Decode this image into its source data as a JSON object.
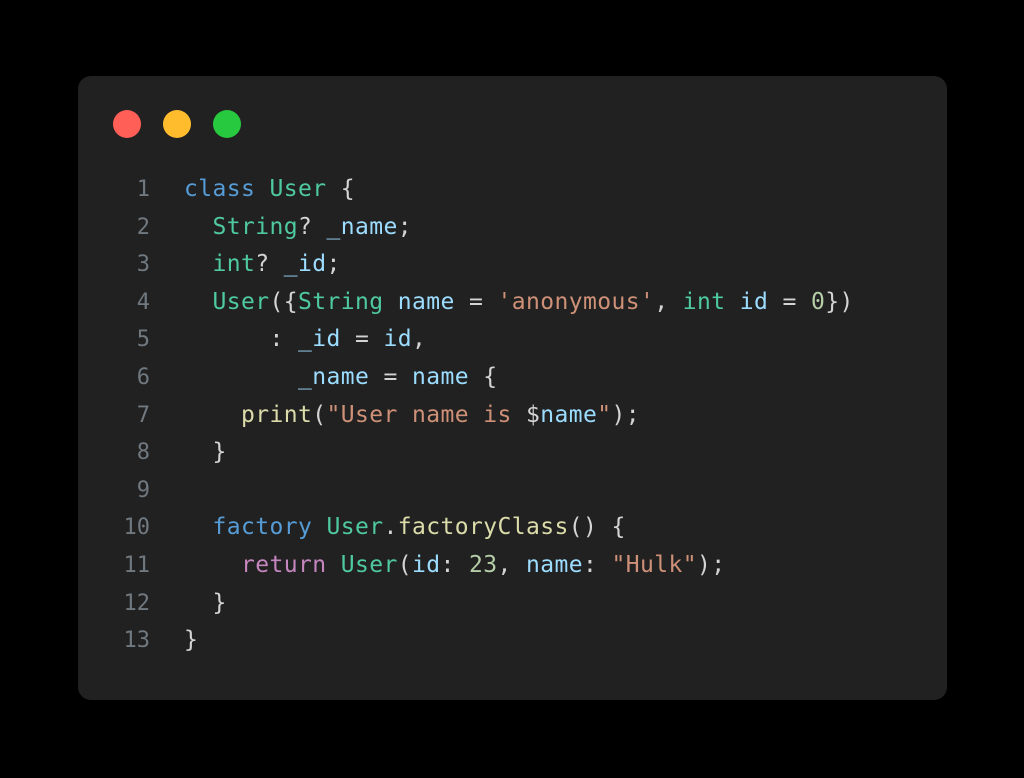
{
  "page": {
    "background_color": "#000000"
  },
  "card": {
    "background_color": "#212121",
    "corner_radius_px": 13
  },
  "titlebar": {
    "dots": [
      {
        "name": "close",
        "color": "#ff5f56"
      },
      {
        "name": "minimize",
        "color": "#ffbd2e"
      },
      {
        "name": "maximize",
        "color": "#27c93f"
      }
    ]
  },
  "editor": {
    "language": "dart",
    "line_number_color": "#707880",
    "default_text_color": "#d4d4d4",
    "line_numbers": [
      "1",
      "2",
      "3",
      "4",
      "5",
      "6",
      "7",
      "8",
      "9",
      "10",
      "11",
      "12",
      "13"
    ],
    "plain_text": [
      "class User {",
      "  String? _name;",
      "  int? _id;",
      "  User({String name = 'anonymous', int id = 0})",
      "      : _id = id,",
      "        _name = name {",
      "    print(\"User name is $name\");",
      "  }",
      "",
      "  factory User.factoryClass() {",
      "    return User(id: 23, name: \"Hulk\");",
      "  }",
      "}"
    ],
    "lines": [
      {
        "number": "1",
        "tokens": [
          {
            "text": "class",
            "type": "keyword"
          },
          {
            "text": " ",
            "type": "punct"
          },
          {
            "text": "User",
            "type": "type"
          },
          {
            "text": " {",
            "type": "punct"
          }
        ]
      },
      {
        "number": "2",
        "tokens": [
          {
            "text": "  ",
            "type": "punct"
          },
          {
            "text": "String",
            "type": "type"
          },
          {
            "text": "? ",
            "type": "punct"
          },
          {
            "text": "_name",
            "type": "var"
          },
          {
            "text": ";",
            "type": "punct"
          }
        ]
      },
      {
        "number": "3",
        "tokens": [
          {
            "text": "  ",
            "type": "punct"
          },
          {
            "text": "int",
            "type": "type"
          },
          {
            "text": "? ",
            "type": "punct"
          },
          {
            "text": "_id",
            "type": "var"
          },
          {
            "text": ";",
            "type": "punct"
          }
        ]
      },
      {
        "number": "4",
        "tokens": [
          {
            "text": "  ",
            "type": "punct"
          },
          {
            "text": "User",
            "type": "type"
          },
          {
            "text": "({",
            "type": "punct"
          },
          {
            "text": "String",
            "type": "type"
          },
          {
            "text": " ",
            "type": "punct"
          },
          {
            "text": "name",
            "type": "var"
          },
          {
            "text": " = ",
            "type": "punct"
          },
          {
            "text": "'anonymous'",
            "type": "string"
          },
          {
            "text": ", ",
            "type": "punct"
          },
          {
            "text": "int",
            "type": "type"
          },
          {
            "text": " ",
            "type": "punct"
          },
          {
            "text": "id",
            "type": "var"
          },
          {
            "text": " = ",
            "type": "punct"
          },
          {
            "text": "0",
            "type": "number"
          },
          {
            "text": "})",
            "type": "punct"
          }
        ]
      },
      {
        "number": "5",
        "tokens": [
          {
            "text": "      : ",
            "type": "punct"
          },
          {
            "text": "_id",
            "type": "var"
          },
          {
            "text": " = ",
            "type": "punct"
          },
          {
            "text": "id",
            "type": "var"
          },
          {
            "text": ",",
            "type": "punct"
          }
        ]
      },
      {
        "number": "6",
        "tokens": [
          {
            "text": "        ",
            "type": "punct"
          },
          {
            "text": "_name",
            "type": "var"
          },
          {
            "text": " = ",
            "type": "punct"
          },
          {
            "text": "name",
            "type": "var"
          },
          {
            "text": " {",
            "type": "punct"
          }
        ]
      },
      {
        "number": "7",
        "tokens": [
          {
            "text": "    ",
            "type": "punct"
          },
          {
            "text": "print",
            "type": "func"
          },
          {
            "text": "(",
            "type": "punct"
          },
          {
            "text": "\"User name is ",
            "type": "string"
          },
          {
            "text": "$",
            "type": "punct"
          },
          {
            "text": "name",
            "type": "var"
          },
          {
            "text": "\"",
            "type": "string"
          },
          {
            "text": ");",
            "type": "punct"
          }
        ]
      },
      {
        "number": "8",
        "tokens": [
          {
            "text": "  }",
            "type": "punct"
          }
        ]
      },
      {
        "number": "9",
        "tokens": [
          {
            "text": "",
            "type": "punct"
          }
        ]
      },
      {
        "number": "10",
        "tokens": [
          {
            "text": "  ",
            "type": "punct"
          },
          {
            "text": "factory",
            "type": "keyword"
          },
          {
            "text": " ",
            "type": "punct"
          },
          {
            "text": "User",
            "type": "type"
          },
          {
            "text": ".",
            "type": "punct"
          },
          {
            "text": "factoryClass",
            "type": "func"
          },
          {
            "text": "() {",
            "type": "punct"
          }
        ]
      },
      {
        "number": "11",
        "tokens": [
          {
            "text": "    ",
            "type": "punct"
          },
          {
            "text": "return",
            "type": "control"
          },
          {
            "text": " ",
            "type": "punct"
          },
          {
            "text": "User",
            "type": "type"
          },
          {
            "text": "(",
            "type": "punct"
          },
          {
            "text": "id",
            "type": "var"
          },
          {
            "text": ": ",
            "type": "punct"
          },
          {
            "text": "23",
            "type": "number"
          },
          {
            "text": ", ",
            "type": "punct"
          },
          {
            "text": "name",
            "type": "var"
          },
          {
            "text": ": ",
            "type": "punct"
          },
          {
            "text": "\"Hulk\"",
            "type": "string"
          },
          {
            "text": ");",
            "type": "punct"
          }
        ]
      },
      {
        "number": "12",
        "tokens": [
          {
            "text": "  }",
            "type": "punct"
          }
        ]
      },
      {
        "number": "13",
        "tokens": [
          {
            "text": "}",
            "type": "punct"
          }
        ]
      }
    ],
    "token_colors": {
      "keyword": "#569cd6",
      "control": "#c586c0",
      "type": "#4ec9a0",
      "var": "#9cdcfe",
      "func": "#dcdcaa",
      "string": "#ce9178",
      "number": "#b5cea8",
      "punct": "#d4d4d4"
    }
  }
}
